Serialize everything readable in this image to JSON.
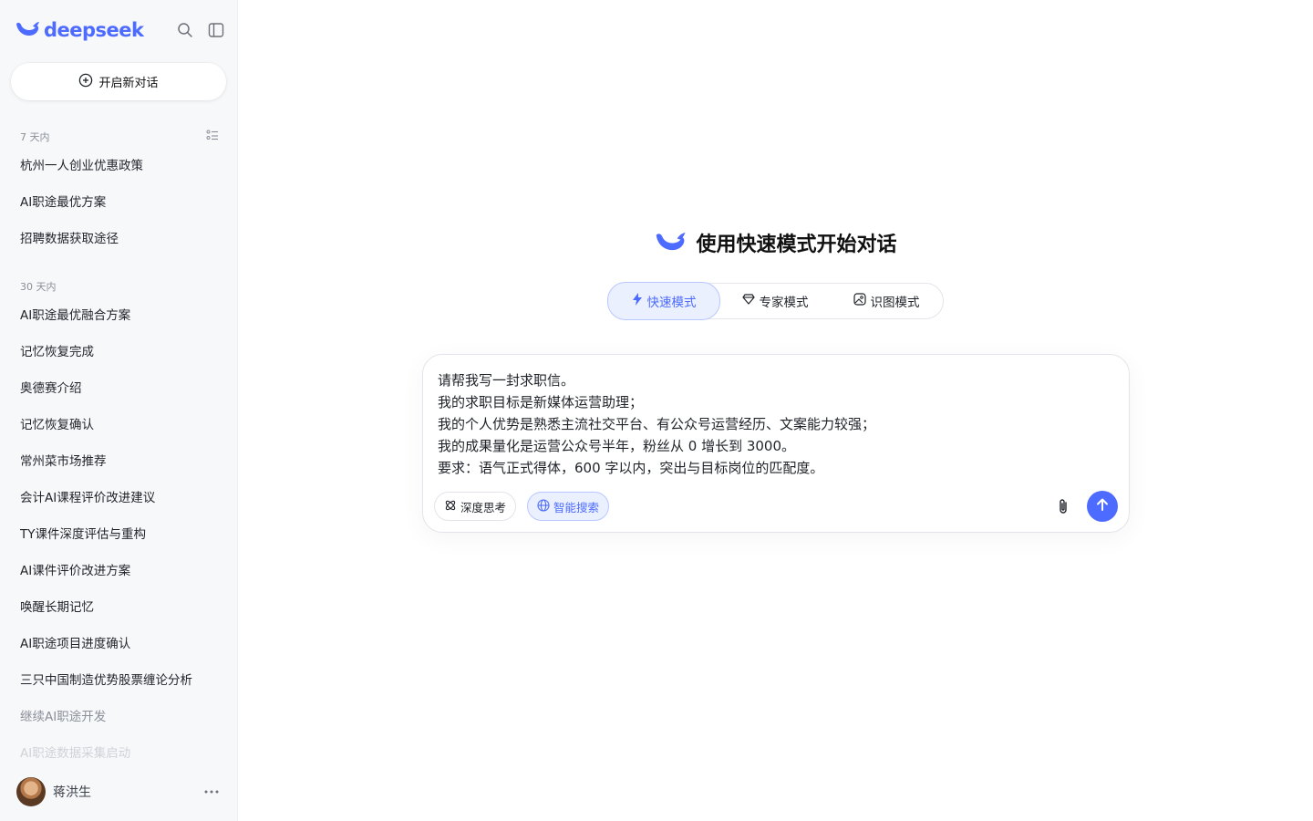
{
  "brand": {
    "name": "deepseek",
    "accent": "#4d6bfe"
  },
  "sidebar": {
    "new_chat_label": "开启新对话",
    "sections": [
      {
        "label": "7 天内",
        "items": [
          "杭州一人创业优惠政策",
          "AI职途最优方案",
          "招聘数据获取途径"
        ]
      },
      {
        "label": "30 天内",
        "items": [
          "AI职途最优融合方案",
          "记忆恢复完成",
          "奥德赛介绍",
          "记忆恢复确认",
          "常州菜市场推荐",
          "会计AI课程评价改进建议",
          "TY课件深度评估与重构",
          "AI课件评价改进方案",
          "唤醒长期记忆",
          "AI职途项目进度确认",
          "三只中国制造优势股票缠论分析",
          "继续AI职途开发",
          "AI职途数据采集启动"
        ]
      }
    ],
    "user": {
      "name": "蒋洪生"
    }
  },
  "main": {
    "title": "使用快速模式开始对话",
    "modes": [
      {
        "label": "快速模式",
        "icon": "bolt-icon",
        "active": true
      },
      {
        "label": "专家模式",
        "icon": "diamond-icon",
        "active": false
      },
      {
        "label": "识图模式",
        "icon": "image-recognition-icon",
        "active": false
      }
    ],
    "composer": {
      "text": "请帮我写一封求职信。\n我的求职目标是新媒体运营助理；\n我的个人优势是熟悉主流社交平台、有公众号运营经历、文案能力较强；\n我的成果量化是运营公众号半年，粉丝从 0 增长到 3000。\n要求：语气正式得体，600 字以内，突出与目标岗位的匹配度。",
      "deep_think_label": "深度思考",
      "smart_search_label": "智能搜索"
    }
  }
}
